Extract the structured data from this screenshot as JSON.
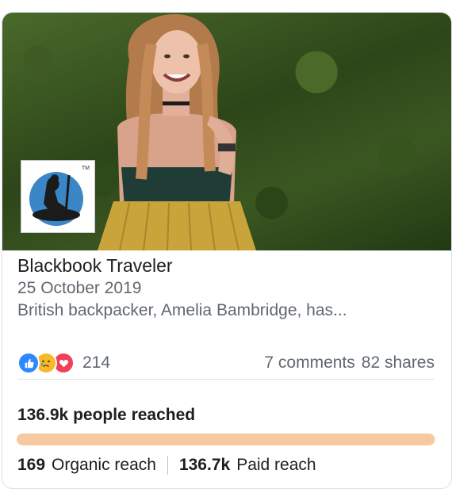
{
  "post": {
    "page_name": "Blackbook Traveler",
    "date": "25 October 2019",
    "description": "British backpacker, Amelia Bambridge, has...",
    "logo_mark": "TM"
  },
  "engagement": {
    "reactions": [
      "like-icon",
      "sad-icon",
      "love-icon"
    ],
    "reaction_count": "214",
    "comments": "7 comments",
    "shares": "82 shares"
  },
  "reach": {
    "total_label": "136.9k people reached",
    "organic_value": "169",
    "organic_label": "Organic reach",
    "paid_value": "136.7k",
    "paid_label": "Paid reach",
    "paid_fraction": 0.9988
  },
  "colors": {
    "like": "#2d88ff",
    "sad": "#f7b928",
    "love": "#f33e58",
    "reach_bar": "#f7c9a0"
  }
}
